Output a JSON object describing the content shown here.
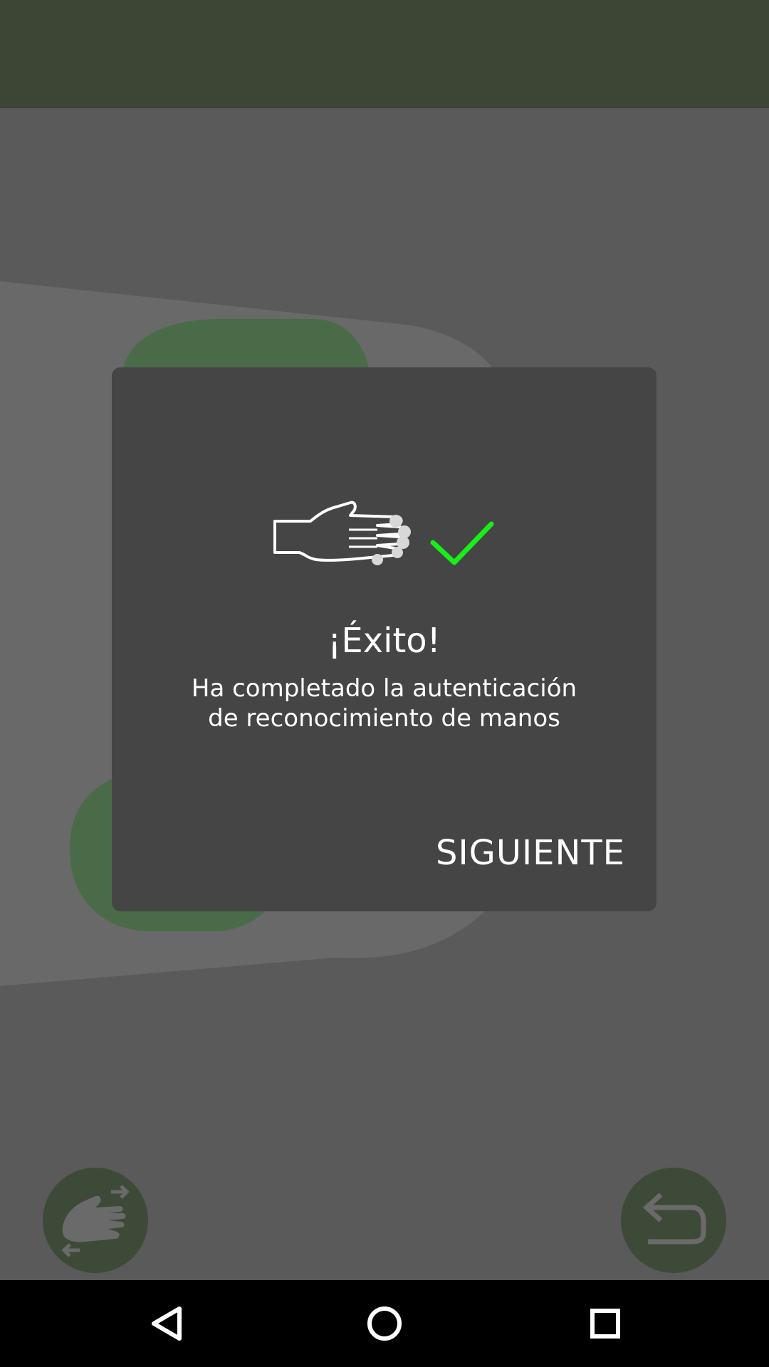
{
  "dialog": {
    "title": "¡Éxito!",
    "message_line1": "Ha completado la autenticación",
    "message_line2": "de reconocimiento de manos",
    "next_label": "SIGUIENTE",
    "check_color": "#1aee1a"
  },
  "icons": {
    "dialog_icon": "hand-scan-icon",
    "success": "checkmark-icon",
    "fab_left": "switch-hand-icon",
    "fab_right": "undo-icon",
    "nav_back": "back-triangle-icon",
    "nav_home": "home-circle-icon",
    "nav_recents": "recents-square-icon"
  },
  "colors": {
    "accent_green": "#4a6b48",
    "dialog_bg": "#454545"
  }
}
